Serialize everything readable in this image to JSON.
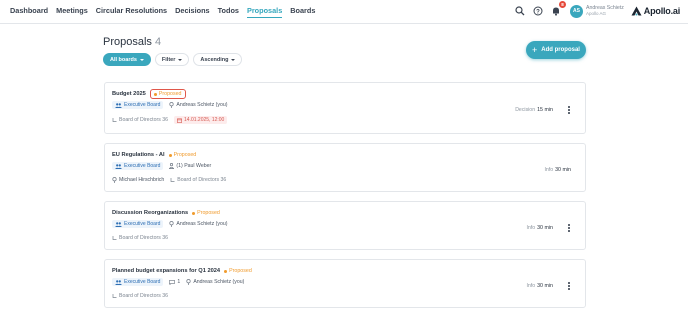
{
  "nav": {
    "items": [
      "Dashboard",
      "Meetings",
      "Circular Resolutions",
      "Decisions",
      "Todos",
      "Proposals",
      "Boards"
    ],
    "active_index": 5
  },
  "header_right": {
    "notification_count": "8",
    "avatar_initials": "AS",
    "user_name": "Andreas Schietz",
    "user_org": "Apollo AG",
    "logo_text": "Apollo.ai"
  },
  "page": {
    "title": "Proposals",
    "count": "4",
    "add_label": "Add proposal"
  },
  "filters": {
    "boards_label": "All boards",
    "filter_label": "Filter",
    "sort_label": "Ascending"
  },
  "proposals": [
    {
      "title": "Budget 2025",
      "status": "Proposed",
      "board_chip": "Executive Board",
      "owner": "Andreas Schietz (you)",
      "target_board": "Board of Directors 36",
      "date": "14.01.2025, 12:00",
      "type": "Decision",
      "duration": "15 min"
    },
    {
      "title": "EU Regulations - AI",
      "status": "Proposed",
      "board_chip": "Executive Board",
      "participants": "(1) Paul Weber",
      "owner": "Michael Hirschbrich",
      "target_board": "Board of Directors 36",
      "type": "Info",
      "duration": "30 min"
    },
    {
      "title": "Discussion Reorganizations",
      "status": "Proposed",
      "board_chip": "Executive Board",
      "owner": "Andreas Schietz (you)",
      "target_board": "Board of Directors 36",
      "type": "Info",
      "duration": "30 min"
    },
    {
      "title": "Planned budget expansions for Q1 2024",
      "status": "Proposed",
      "board_chip": "Executive Board",
      "comments": "1",
      "owner": "Andreas Schietz (you)",
      "target_board": "Board of Directors 36",
      "type": "Info",
      "duration": "30 min"
    }
  ],
  "colors": {
    "accent": "#3aa7bd",
    "status_proposed": "#f09b2d",
    "date_chip": "#d65a52",
    "notification": "#e5493a"
  }
}
